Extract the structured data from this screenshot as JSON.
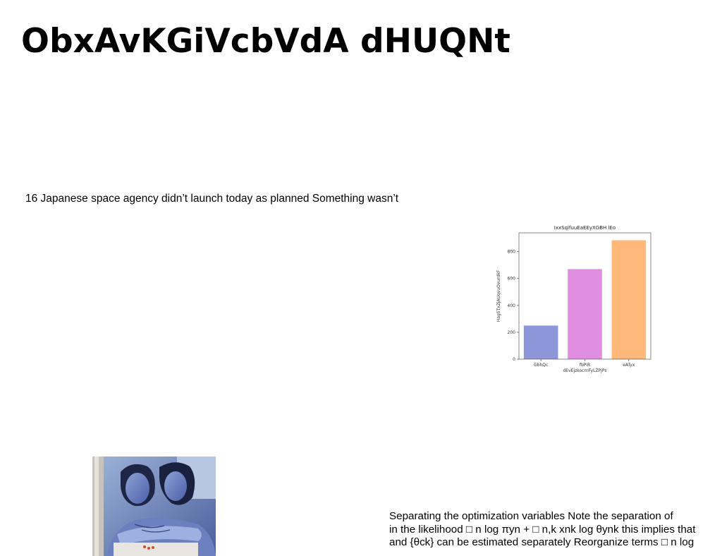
{
  "slide": {
    "title": "ObxAvKGiVcbVdA dHUQNt",
    "subtitle": "16 Japanese space agency didn’t launch today as planned Something wasn’t"
  },
  "body_text": {
    "lines": [
      "Separating the optimization variables Note the separation of",
      "in the likelihood □ n log πyn + □ n,k xnk log θynk this implies that",
      "and {θck} can be estimated separately Reorganize terms □ n log"
    ]
  },
  "photo": {
    "icon": "photo-two-people-in-car"
  },
  "chart_data": {
    "type": "bar",
    "title": "IxxSqlfuuEaEEyXGBH lEo",
    "xlabel": "dEvEjzkocrnFyLZPjPs",
    "ylabel": "HagSTxZjAUqvuOvurdkF",
    "categories": [
      "GbhQc",
      "fbPiR",
      "eATyx"
    ],
    "values": [
      250,
      670,
      885
    ],
    "colors": [
      "#8c96d8",
      "#e08ee0",
      "#ffb87a"
    ],
    "ylim": [
      0,
      940
    ],
    "yticks": [
      0,
      200,
      400,
      600,
      800
    ],
    "grid": false,
    "legend": "none"
  }
}
